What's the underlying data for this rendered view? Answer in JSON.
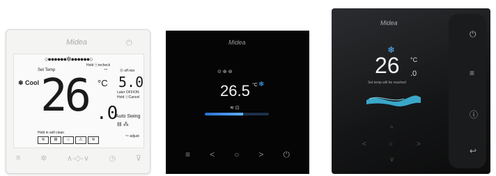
{
  "panel1": {
    "logo": "Midea",
    "power_icon": "power-icon",
    "top_dots": "○●●●●●●✲●●●●●●○",
    "hold_recheck": "Hold ⓢrecheck",
    "mode_label": "❄ Cool",
    "set_temp_label": "Set Temp",
    "temperature": "26",
    "temperature_decimal": ".0",
    "unit": "°C",
    "off_min_label": "⓪ off min",
    "timer_value": "5.0",
    "later_off_label": "Later OFF/ON Hold ⓢCancel",
    "auto_swing_label": "Auto Swing",
    "hold_clean_label": "Hold in self clean",
    "mode_icons": [
      "≋",
      "⊞",
      "⌂",
      "⚠",
      "≋"
    ],
    "swing_icons": "⊟ ⁂",
    "adjust_label": "〜 adjust",
    "bottom_buttons": [
      "≡",
      "✲",
      "∧-◇-∨",
      "◷",
      "⊽"
    ]
  },
  "panel2": {
    "logo": "Midea",
    "status_icons": "⊙ ⊛ ⊚",
    "temperature": "26.5",
    "unit": "°C",
    "snow_icon": "snowflake-icon",
    "small_icons": "≋ ⊡",
    "nav_buttons": [
      "≡",
      "<",
      "○",
      ">",
      "⏻"
    ]
  },
  "panel3": {
    "logo": "Midea",
    "temperature": "26",
    "temperature_decimal": ".0",
    "unit": "°C",
    "message": "Set temp will be reached",
    "side_buttons": [
      "⏻",
      "≡",
      "ⓘ",
      "↩"
    ],
    "nav_buttons": [
      "^",
      "<",
      "○",
      ">",
      "v"
    ]
  },
  "colors": {
    "accent": "#4fb0ff",
    "panel_dark": "#050505",
    "panel_light": "#f4f4f2"
  }
}
